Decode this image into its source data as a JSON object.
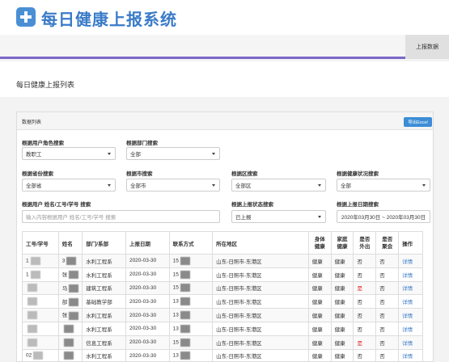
{
  "app": {
    "title": "每日健康上报系统"
  },
  "nav": {
    "items": [
      "上报数据"
    ]
  },
  "page": {
    "title": "每日健康上报列表"
  },
  "panel": {
    "title": "数据列表",
    "export_label": "导出Excel"
  },
  "filters": {
    "role": {
      "label": "根据用户角色搜索",
      "value": "教职工"
    },
    "dept": {
      "label": "根据部门搜索",
      "value": "全部"
    },
    "province": {
      "label": "根据省份搜索",
      "value": "全部省"
    },
    "city": {
      "label": "根据市搜索",
      "value": "全部市"
    },
    "district": {
      "label": "根据区搜索",
      "value": "全部区"
    },
    "health": {
      "label": "根据健康状况搜索",
      "value": "全部"
    },
    "user": {
      "label": "根据用户 姓名/工号/学号 搜索",
      "placeholder": "输入内容根据用户 姓名/工号/学号 搜索"
    },
    "status": {
      "label": "根据上报状态搜索",
      "value": "已上报"
    },
    "date": {
      "label": "根据上报日期搜索",
      "value": "2020年03月30日 ~ 2020年03月30日"
    }
  },
  "table": {
    "headers": [
      "工号/学号",
      "姓名",
      "部门/系部",
      "上报日期",
      "联系方式",
      "所在地区",
      "身体健康",
      "家庭健康",
      "是否外出",
      "是否聚会",
      "操作"
    ],
    "header_lines": {
      "body_health": [
        "身体",
        "健康"
      ],
      "family_health": [
        "家庭",
        "健康"
      ],
      "went_out": [
        "是否",
        "外出"
      ],
      "gathering": [
        "是否",
        "聚会"
      ]
    },
    "rows": [
      {
        "id": "1",
        "name": "3",
        "dept": "水利工程系",
        "date": "2020-03-30",
        "phone": "15",
        "region": "山东-日照市-东港区",
        "body": "健康",
        "family": "健康",
        "out": "否",
        "party": "否",
        "action": "详情"
      },
      {
        "id": "1",
        "name": "张",
        "dept": "水利工程系",
        "date": "2020-03-30",
        "phone": "15",
        "region": "山东-日照市-东港区",
        "body": "健康",
        "family": "健康",
        "out": "否",
        "party": "否",
        "action": "详情"
      },
      {
        "id": "",
        "name": "马",
        "dept": "建筑工程系",
        "date": "2020-03-30",
        "phone": "15",
        "region": "山东-日照市-东港区",
        "body": "健康",
        "family": "健康",
        "out": "是",
        "party": "否",
        "action": "详情"
      },
      {
        "id": "",
        "name": "部",
        "dept": "基础教学部",
        "date": "2020-03-30",
        "phone": "13",
        "region": "山东-日照市-东港区",
        "body": "健康",
        "family": "健康",
        "out": "否",
        "party": "否",
        "action": "详情"
      },
      {
        "id": "",
        "name": "张",
        "dept": "水利工程系",
        "date": "2020-03-30",
        "phone": "13",
        "region": "山东-日照市-东港区",
        "body": "健康",
        "family": "健康",
        "out": "否",
        "party": "否",
        "action": "详情"
      },
      {
        "id": "",
        "name": "",
        "dept": "水利工程系",
        "date": "2020-03-30",
        "phone": "13",
        "region": "山东-日照市-东港区",
        "body": "健康",
        "family": "健康",
        "out": "否",
        "party": "否",
        "action": "详情"
      },
      {
        "id": "",
        "name": "",
        "dept": "信息工程系",
        "date": "2020-03-30",
        "phone": "15",
        "region": "山东-日照市-东港区",
        "body": "健康",
        "family": "健康",
        "out": "是",
        "party": "否",
        "action": "详情"
      },
      {
        "id": "02",
        "name": "",
        "dept": "水利工程系",
        "date": "2020-03-30",
        "phone": "13",
        "region": "山东-日照市-东港区",
        "body": "健康",
        "family": "健康",
        "out": "否",
        "party": "否",
        "action": "详情"
      }
    ]
  },
  "colors": {
    "accent": "#3a7bc8",
    "nav_underline": "#7b68c8",
    "warn": "#e02020"
  }
}
